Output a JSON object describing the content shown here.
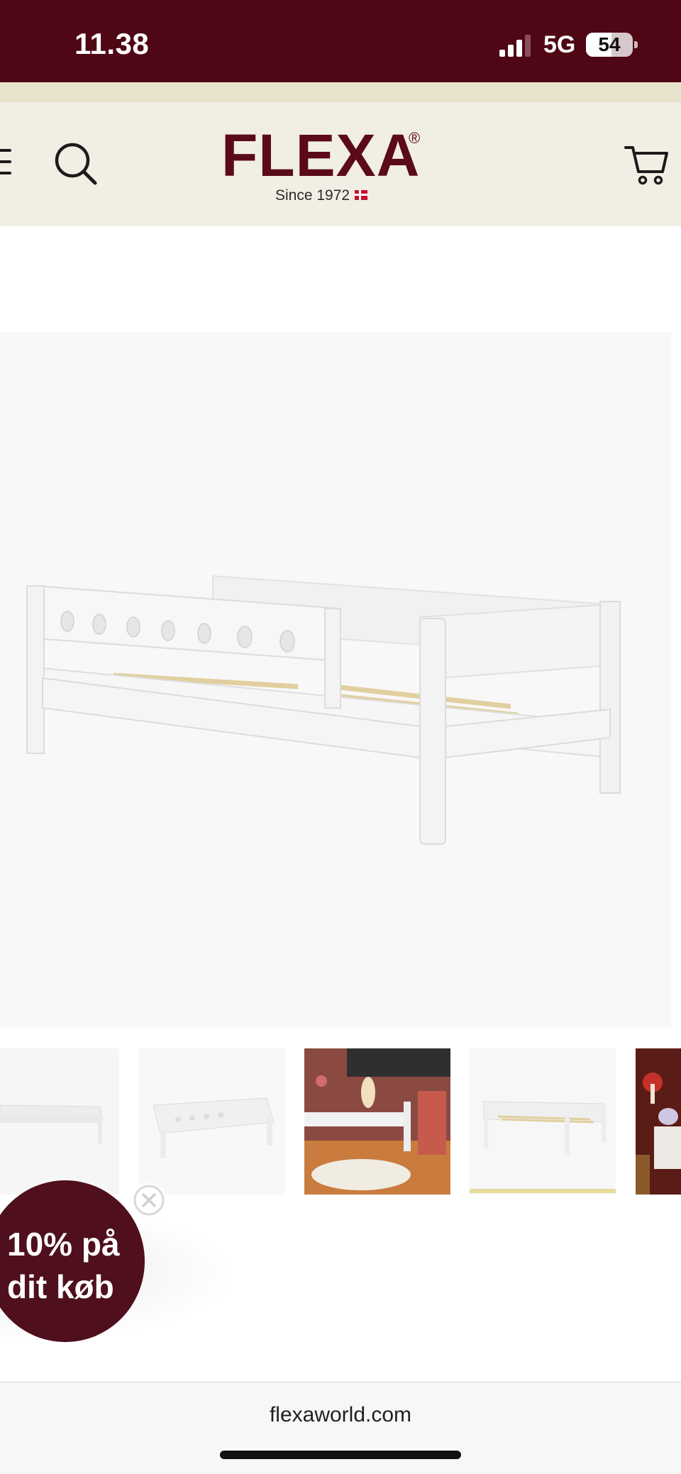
{
  "status_bar": {
    "time": "11.38",
    "network": "5G",
    "battery_level": "54",
    "battery_fraction": 0.54
  },
  "header": {
    "logo_word": "FLEXA",
    "logo_reg": "®",
    "logo_tagline": "Since 1972",
    "brand_color": "#5a0a19",
    "bar_color": "#4f0715"
  },
  "icons": {
    "menu": "hamburger-menu",
    "search": "magnifying-glass",
    "cart": "shopping-cart",
    "close": "close-x"
  },
  "product_image": {
    "subject": "white-bed-with-safety-rail"
  },
  "thumbnails": [
    {
      "subject": "white-bed-side-view",
      "active": false
    },
    {
      "subject": "white-bed-with-guard-rail",
      "active": false
    },
    {
      "subject": "kids-room-with-bed",
      "active": false
    },
    {
      "subject": "white-bed-with-slats",
      "active": true
    },
    {
      "subject": "room-with-mushroom-lamp",
      "active": false
    }
  ],
  "discount_popup": {
    "text": "10% på dit køb"
  },
  "browser": {
    "url": "flexaworld.com"
  }
}
